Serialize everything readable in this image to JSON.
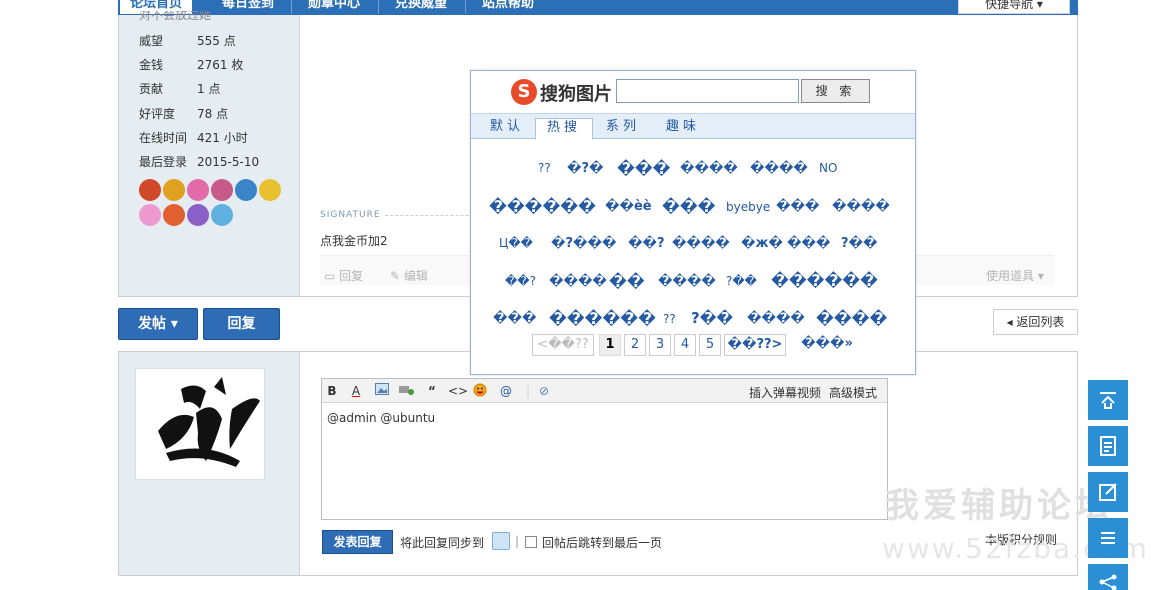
{
  "nav": {
    "tabs": [
      "论坛首页",
      "每日签到",
      "勋章中心",
      "兑换威望",
      "站点帮助"
    ],
    "quick_nav": "快捷导航 ▾"
  },
  "profile": {
    "motto": "对不会放过她",
    "stats": [
      {
        "key": "威望",
        "value": "555 点"
      },
      {
        "key": "金钱",
        "value": "2761 枚"
      },
      {
        "key": "贡献",
        "value": "1 点"
      },
      {
        "key": "好评度",
        "value": "78 点"
      },
      {
        "key": "在线时间",
        "value": "421 小时"
      },
      {
        "key": "最后登录",
        "value": "2015-5-10"
      }
    ]
  },
  "post": {
    "signature_label": "SIGNATURE",
    "signature_text": "点我金币加2",
    "reply_label": "回复",
    "edit_label": "编辑",
    "use_tool_label": "使用道具 ▾"
  },
  "actions": {
    "new_post": "发帖 ▾",
    "reply": "回复",
    "back_to_list": "◂ 返回列表"
  },
  "editor": {
    "insert_danmaku": "插入弹幕视频",
    "advanced_mode": "高级模式",
    "content": "@admin @ubuntu",
    "submit": "发表回复",
    "sync_text": "将此回复同步到",
    "jump_text": "回帖后跳转到最后一页",
    "credit_rules": "本版积分规则",
    "toolbar_b": "B",
    "toolbar_a": "A",
    "toolbar_quote": "“",
    "toolbar_code": "<>",
    "toolbar_at": "@"
  },
  "watermark": {
    "line1": "我爱辅助论坛",
    "line2": "www.52fzba.com"
  },
  "sogou": {
    "logo_letter": "S",
    "name": "搜狗图片",
    "search_value": "",
    "search_button": "搜 索",
    "tabs": [
      "默认",
      "热搜",
      "系列",
      "趣味"
    ],
    "keywords": [
      [
        "??",
        "�?�",
        "���",
        "����",
        "����",
        "NO"
      ],
      [
        "������",
        "��èè",
        "���",
        "byebye",
        "���",
        "����"
      ],
      [
        "Ц��",
        "�?���",
        "��?",
        "����",
        "�ж�",
        "���",
        "?��"
      ],
      [
        "��?",
        "����",
        "��",
        "����",
        "?��",
        "������"
      ],
      [
        "���",
        "������",
        "??",
        "?��",
        "����",
        "����"
      ]
    ],
    "pagination": {
      "prev": "<��??",
      "pages": [
        "1",
        "2",
        "3",
        "4",
        "5"
      ],
      "next": "��??>",
      "last": "���»"
    }
  },
  "colors": {
    "nav_blue": "#2b6fb6",
    "button_blue": "#2e6db5",
    "float_blue": "#2b8fd6",
    "sidebar_bg": "#e5edf2",
    "keyword_blue": "#2459a4",
    "sogou_red": "#e84a2a"
  },
  "icons": [
    "up-arrow-icon",
    "document-icon",
    "edit-icon",
    "list-icon",
    "share-icon"
  ]
}
